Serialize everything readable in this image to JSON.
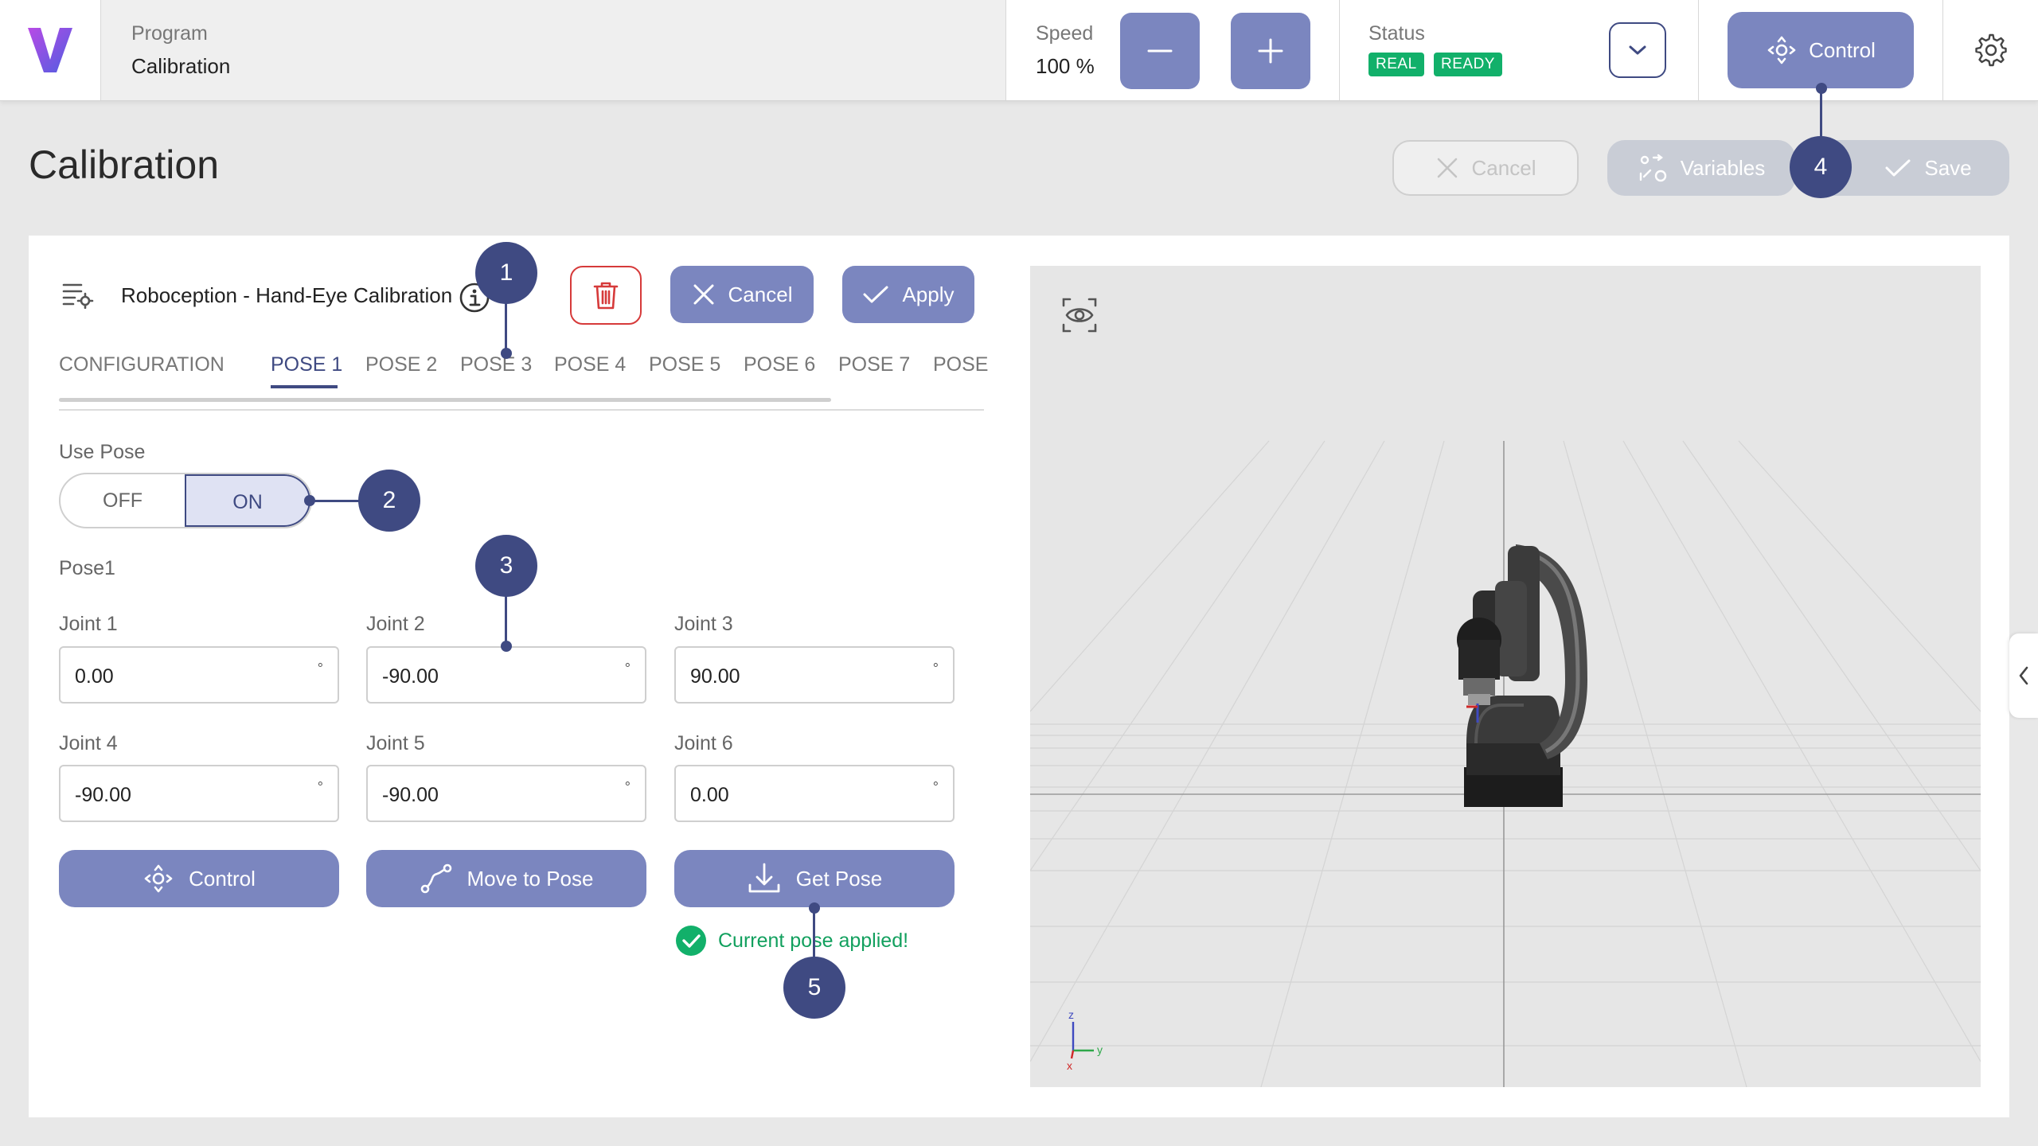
{
  "colors": {
    "primary": "#7b86bf",
    "dark_accent": "#3f4a82",
    "success": "#12b06a",
    "danger": "#d63a3a"
  },
  "topbar": {
    "logo": "V",
    "program_label": "Program",
    "program_value": "Calibration",
    "speed_label": "Speed",
    "speed_value": "100 %",
    "status_label": "Status",
    "status_badges": [
      "REAL",
      "READY"
    ],
    "control_label": "Control"
  },
  "header": {
    "title": "Calibration",
    "cancel_label": "Cancel",
    "variables_label": "Variables",
    "save_label": "Save"
  },
  "panel": {
    "title": "Roboception - Hand-Eye Calibration",
    "cancel_label": "Cancel",
    "apply_label": "Apply",
    "tabs": [
      "CONFIGURATION",
      "POSE 1",
      "POSE 2",
      "POSE 3",
      "POSE 4",
      "POSE 5",
      "POSE 6",
      "POSE 7",
      "POSE"
    ],
    "active_tab": "POSE 1",
    "use_pose_label": "Use Pose",
    "toggle_off": "OFF",
    "toggle_on": "ON",
    "pose_title": "Pose1",
    "joints": [
      {
        "label": "Joint 1",
        "value": "0.00",
        "unit": "°"
      },
      {
        "label": "Joint 2",
        "value": "-90.00",
        "unit": "°"
      },
      {
        "label": "Joint 3",
        "value": "90.00",
        "unit": "°"
      },
      {
        "label": "Joint 4",
        "value": "-90.00",
        "unit": "°"
      },
      {
        "label": "Joint 5",
        "value": "-90.00",
        "unit": "°"
      },
      {
        "label": "Joint 6",
        "value": "0.00",
        "unit": "°"
      }
    ],
    "control_label": "Control",
    "move_label": "Move to Pose",
    "get_pose_label": "Get Pose",
    "success_message": "Current pose applied!"
  },
  "viewer": {
    "axis_z": "z",
    "axis_y": "y",
    "axis_x": "x"
  },
  "callouts": [
    "1",
    "2",
    "3",
    "4",
    "5"
  ]
}
